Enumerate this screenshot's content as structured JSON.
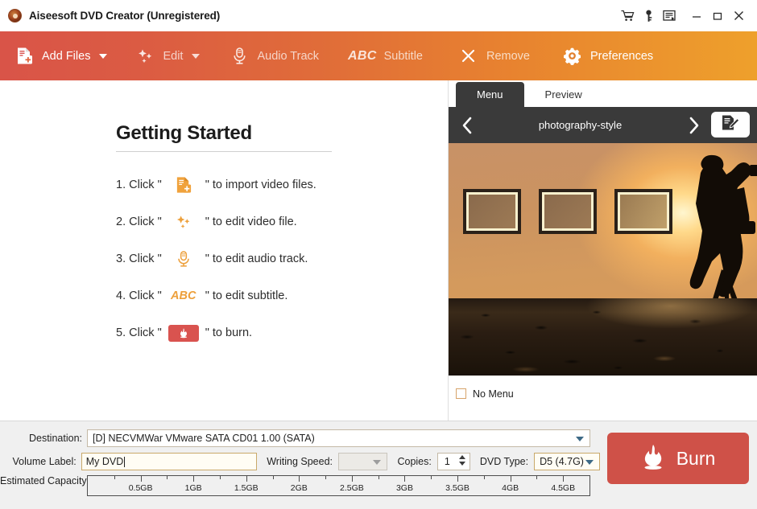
{
  "titlebar": {
    "title": "Aiseesoft DVD Creator (Unregistered)",
    "app_icon": "app-logo-icon",
    "buttons": [
      {
        "name": "cart-icon",
        "tip": "Buy"
      },
      {
        "name": "key-icon",
        "tip": "Register"
      },
      {
        "name": "register-icon",
        "tip": "Register Form"
      },
      {
        "name": "minimize-icon",
        "tip": "Minimize"
      },
      {
        "name": "maximize-icon",
        "tip": "Maximize"
      },
      {
        "name": "close-icon",
        "tip": "Close"
      }
    ]
  },
  "toolbar": {
    "add_files": "Add Files",
    "edit": "Edit",
    "audio_track": "Audio Track",
    "subtitle": "Subtitle",
    "subtitle_icon_text": "ABC",
    "remove": "Remove",
    "preferences": "Preferences"
  },
  "getting_started": {
    "heading": "Getting Started",
    "steps": [
      {
        "num": "1. Click \"",
        "icon": "add-files-icon",
        "tail": "\" to import video files."
      },
      {
        "num": "2. Click \"",
        "icon": "edit-sparkle-icon",
        "tail": "\" to edit video file."
      },
      {
        "num": "3. Click \"",
        "icon": "microphone-icon",
        "tail": "\" to edit audio track."
      },
      {
        "num": "4. Click \"",
        "icon": "abc-icon",
        "icon_text": "ABC",
        "tail": "\" to edit subtitle."
      },
      {
        "num": "5. Click \"",
        "icon": "burn-flame-icon",
        "tail": "\" to burn."
      }
    ]
  },
  "panel": {
    "tabs": [
      {
        "label": "Menu",
        "active": true
      },
      {
        "label": "Preview",
        "active": false
      }
    ],
    "template_name": "photography-style",
    "prev_arrow": "chevron-left-icon",
    "next_arrow": "chevron-right-icon",
    "edit_menu_icon": "edit-menu-document-pencil-icon",
    "preview_scene": "photographer-silhouette-sunset",
    "player_buttons": [
      "skip-previous-icon",
      "rewind-icon",
      "play-icon",
      "fast-forward-icon",
      "skip-next-icon"
    ],
    "no_menu": {
      "label": "No Menu",
      "checked": false
    }
  },
  "bottom": {
    "destination_label": "Destination:",
    "destination_value": "[D] NECVMWar VMware SATA CD01 1.00 (SATA)",
    "volume_label_label": "Volume Label:",
    "volume_label_value": "My DVD",
    "writing_speed_label": "Writing Speed:",
    "writing_speed_value": "",
    "copies_label": "Copies:",
    "copies_value": "1",
    "dvd_type_label": "DVD Type:",
    "dvd_type_value": "D5 (4.7G)",
    "capacity_label": "Estimated Capacity:",
    "capacity_ticks": [
      "0.5GB",
      "1GB",
      "1.5GB",
      "2GB",
      "2.5GB",
      "3GB",
      "3.5GB",
      "4GB",
      "4.5GB"
    ],
    "burn_label": "Burn",
    "burn_icon": "flame-icon"
  },
  "colors": {
    "toolbar_start": "#d95448",
    "toolbar_end": "#eea02c",
    "burn_red": "#cf5148",
    "accent_orange": "#eda03c",
    "panel_dark": "#3a3a3a"
  }
}
